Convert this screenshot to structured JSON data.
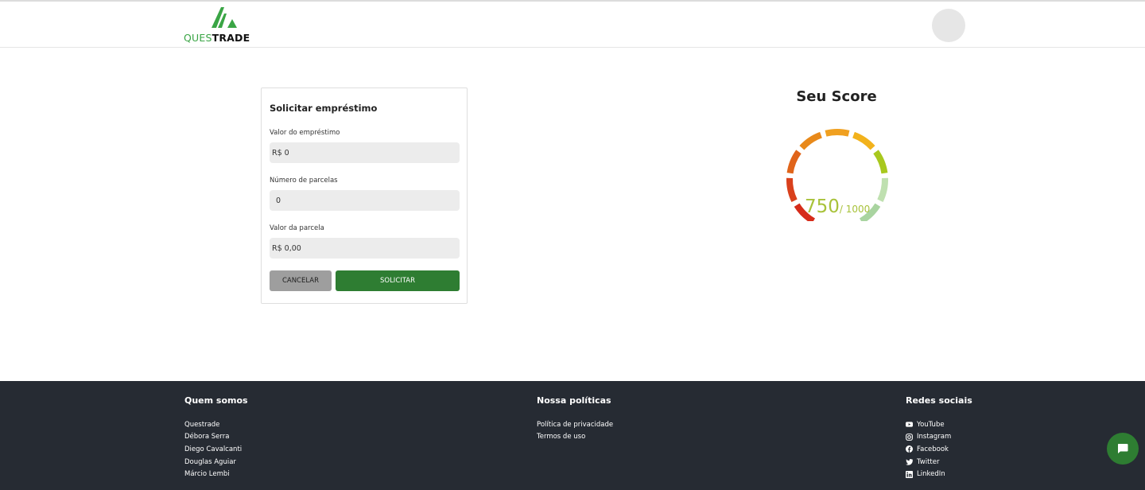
{
  "header": {
    "logo_text_accent": "QUES",
    "logo_text_rest": "TRADE"
  },
  "loan_form": {
    "title": "Solicitar empréstimo",
    "amount_label": "Valor do empréstimo",
    "amount_value": "R$ 0",
    "installments_label": "Número de parcelas",
    "installments_value": "0",
    "installment_value_label": "Valor da parcela",
    "installment_value_value": "R$ 0,00",
    "cancel_label": "CANCELAR",
    "submit_label": "SOLICITAR"
  },
  "score": {
    "title": "Seu Score",
    "value": "750",
    "max": "/ 1000",
    "value_color": "#a8c23a"
  },
  "footer": {
    "about": {
      "heading": "Quem somos",
      "items": [
        "Questrade",
        "Débora Serra",
        "Diego Cavalcanti",
        "Douglas Aguiar",
        "Márcio Lembi"
      ]
    },
    "policies": {
      "heading": "Nossa políticas",
      "items": [
        "Política de privacidade",
        "Termos de uso"
      ]
    },
    "social": {
      "heading": "Redes sociais",
      "items": [
        {
          "label": "YouTube",
          "icon": "youtube-icon"
        },
        {
          "label": "Instagram",
          "icon": "instagram-icon"
        },
        {
          "label": "Facebook",
          "icon": "facebook-icon"
        },
        {
          "label": "Twitter",
          "icon": "twitter-icon"
        },
        {
          "label": "LinkedIn",
          "icon": "linkedin-icon"
        }
      ]
    }
  },
  "colors": {
    "brand_green": "#2e7d32",
    "logo_green": "#3aa545",
    "footer_bg": "#262b33"
  }
}
